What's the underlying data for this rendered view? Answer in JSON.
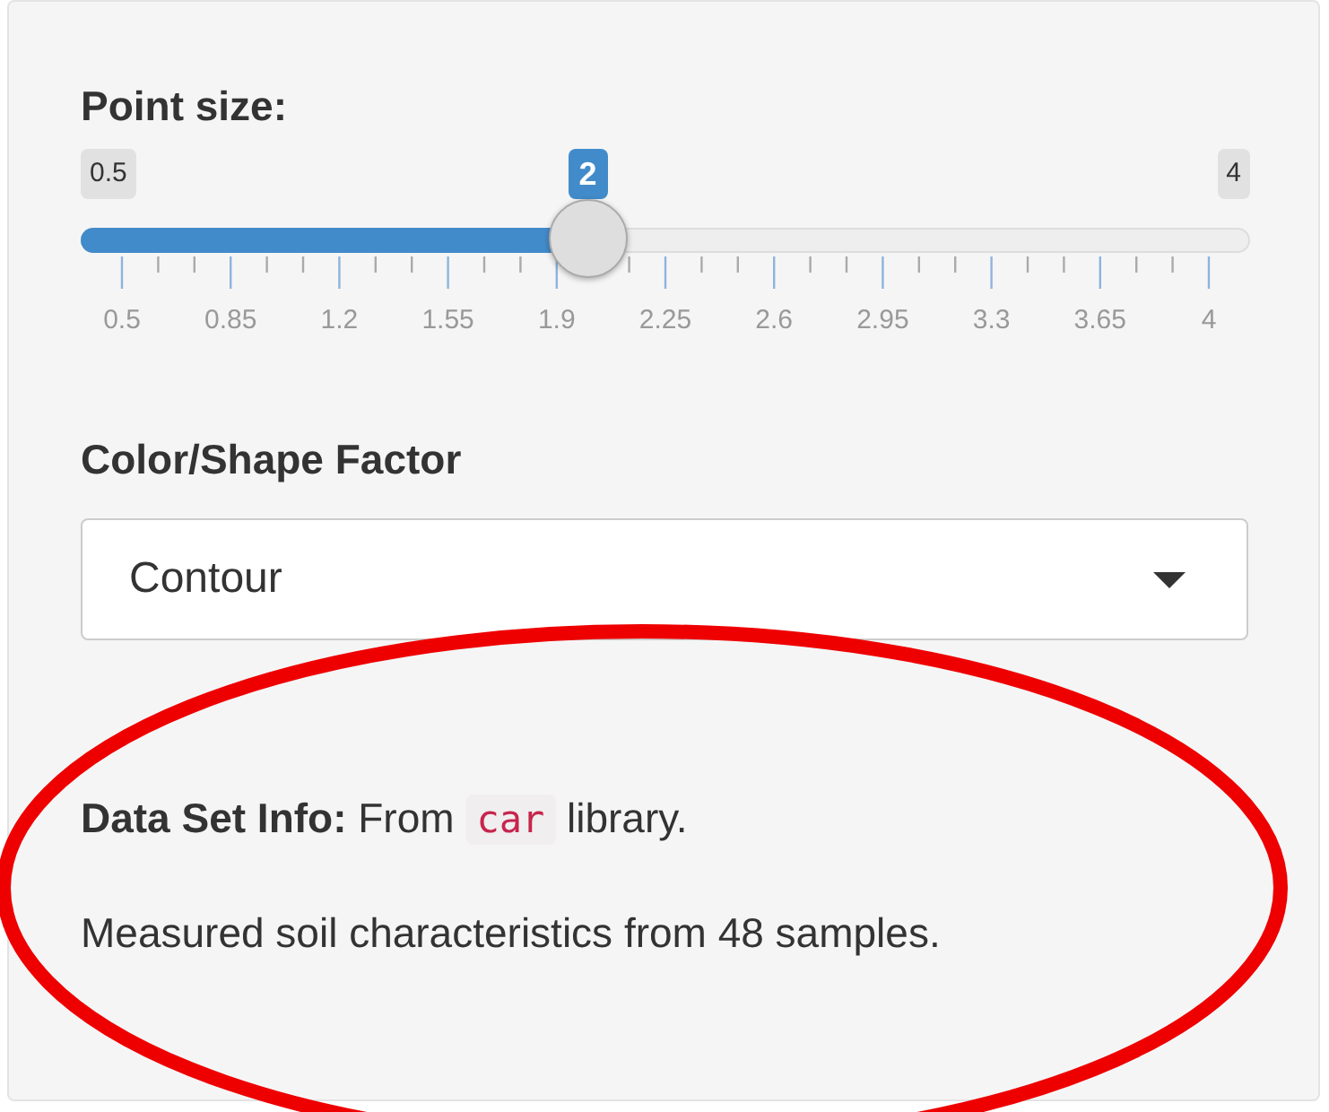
{
  "slider": {
    "label": "Point size:",
    "min_label": "0.5",
    "max_label": "4",
    "value_label": "2",
    "level": 0.4286,
    "tick_labels": [
      "0.5",
      "0.85",
      "1.2",
      "1.55",
      "1.9",
      "2.25",
      "2.6",
      "2.95",
      "3.3",
      "3.65",
      "4"
    ]
  },
  "select": {
    "label": "Color/Shape Factor",
    "value": "Contour"
  },
  "info": [
    {
      "kind": "sentence",
      "before": "**Data Set Info:** From",
      "code": "car",
      "after": "library."
    },
    {
      "kind": "paragraph",
      "text": "Measured soil characteristics from 48 samples."
    }
  ],
  "annotation": {
    "kind": "ellipse"
  }
}
